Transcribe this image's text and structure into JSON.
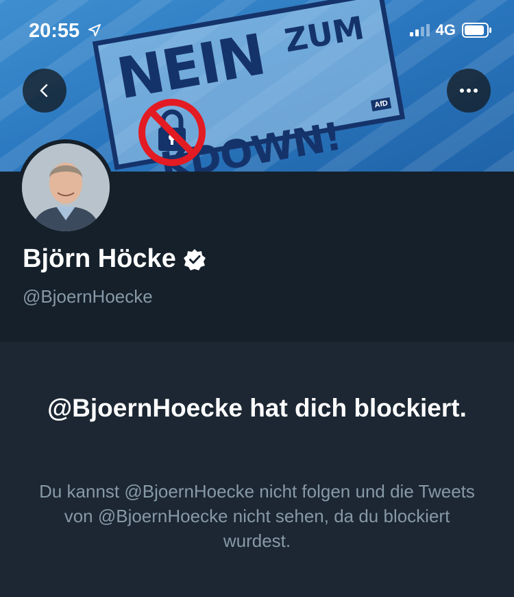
{
  "status_bar": {
    "time": "20:55",
    "network": "4G",
    "icons": [
      "location-arrow-icon",
      "signal-icon",
      "battery-icon"
    ]
  },
  "banner": {
    "line1": "NEIN",
    "line2": "ZUM",
    "line3": "KDOWN!",
    "logo": "AfD",
    "colors": {
      "sky": "#2b78c0",
      "sign_text": "#15336b",
      "no_sign": "#e31b23"
    }
  },
  "nav": {
    "back_icon": "chevron-left-icon",
    "more_icon": "more-horizontal-icon"
  },
  "profile": {
    "display_name": "Björn Höcke",
    "handle": "@BjoernHoecke",
    "verified_icon": "verified-badge-icon"
  },
  "blocked": {
    "title": "@BjoernHoecke hat dich blockiert.",
    "description": "Du kannst @BjoernHoecke nicht folgen und die Tweets von @BjoernHoecke nicht sehen, da du blockiert wurdest."
  },
  "theme": {
    "background": "#15202b",
    "body_background": "#1c2733",
    "secondary_text": "#8899a6"
  }
}
